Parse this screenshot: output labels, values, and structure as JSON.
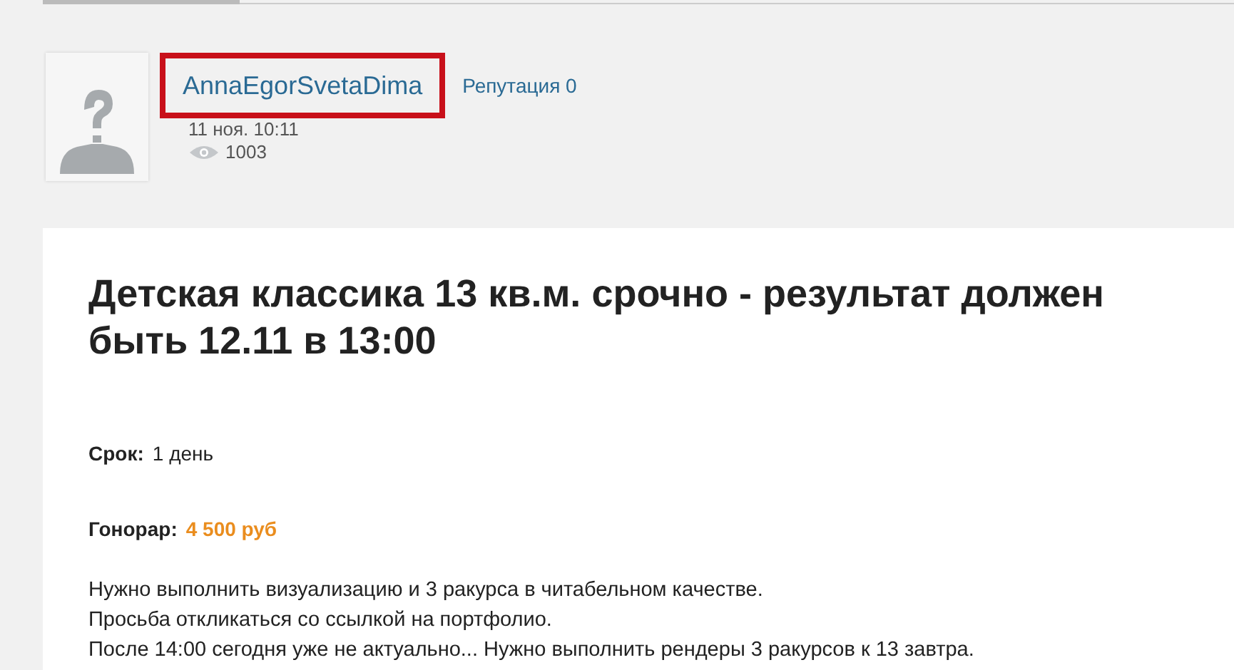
{
  "author": {
    "name": "AnnaEgorSvetaDima",
    "highlighted": true,
    "reputation": "Репутация 0",
    "date": "11 ноя. 10:11",
    "views": "1003"
  },
  "post": {
    "title": "Детская классика 13 кв.м. срочно - результат должен быть 12.11 в 13:00",
    "fields": [
      {
        "label": "Срок:",
        "value": "1 день",
        "kind": "plain"
      },
      {
        "label": "Гонорар:",
        "value": "4 500 руб",
        "kind": "price"
      }
    ],
    "lines": [
      "Нужно выполнить визуализацию и 3 ракурса в читабельном качестве.",
      "Просьба откликаться со ссылкой на портфолио.",
      "После 14:00 сегодня уже не актуально... Нужно выполнить рендеры 3 ракурсов к 13 завтра."
    ]
  }
}
